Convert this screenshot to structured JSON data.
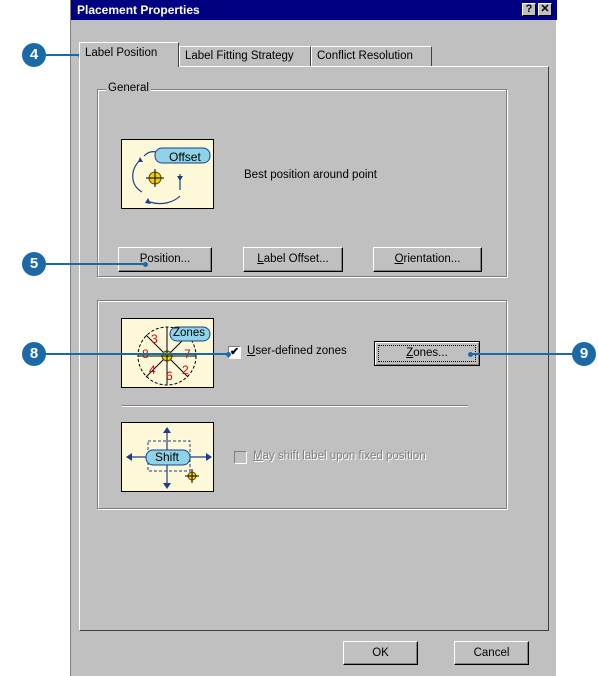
{
  "window": {
    "title": "Placement Properties",
    "help_button": "?",
    "close_button": "✕"
  },
  "tabs": [
    {
      "label": "Label Position",
      "active": true
    },
    {
      "label": "Label Fitting Strategy",
      "active": false
    },
    {
      "label": "Conflict Resolution",
      "active": false
    }
  ],
  "general": {
    "legend": "General",
    "thumbnail_label": "Offset",
    "description": "Best position around point",
    "buttons": {
      "position": {
        "mnemonic": "P",
        "rest": "osition..."
      },
      "label_offset": {
        "mnemonic": "L",
        "rest": "abel Offset..."
      },
      "orientation": {
        "mnemonic": "O",
        "rest": "rientation..."
      }
    }
  },
  "zones": {
    "thumbnail_label": "Zones",
    "zone_numbers": [
      "3",
      "7",
      "8",
      "1",
      "4",
      "6",
      "2"
    ],
    "checkbox": {
      "mnemonic": "U",
      "rest": "ser-defined zones",
      "checked": true
    },
    "button": {
      "mnemonic": "Z",
      "rest": "ones..."
    }
  },
  "shift": {
    "thumbnail_label": "Shift",
    "checkbox": {
      "mnemonic": "M",
      "rest": "ay shift label upon fixed position",
      "checked": false,
      "enabled": false
    }
  },
  "footer": {
    "ok": "OK",
    "cancel": "Cancel"
  },
  "callouts": {
    "tab": "4",
    "position": "5",
    "zones_checkbox": "8",
    "zones_button": "9"
  },
  "colors": {
    "dialog_bg": "#c0c0c0",
    "titlebar": "#000080",
    "callout": "#1b6aa5",
    "thumbnail_bg": "#fdf8d8",
    "badge_fill": "#8fd3e8",
    "marker": "#f2d000",
    "zone_numbers": "#e00000"
  }
}
